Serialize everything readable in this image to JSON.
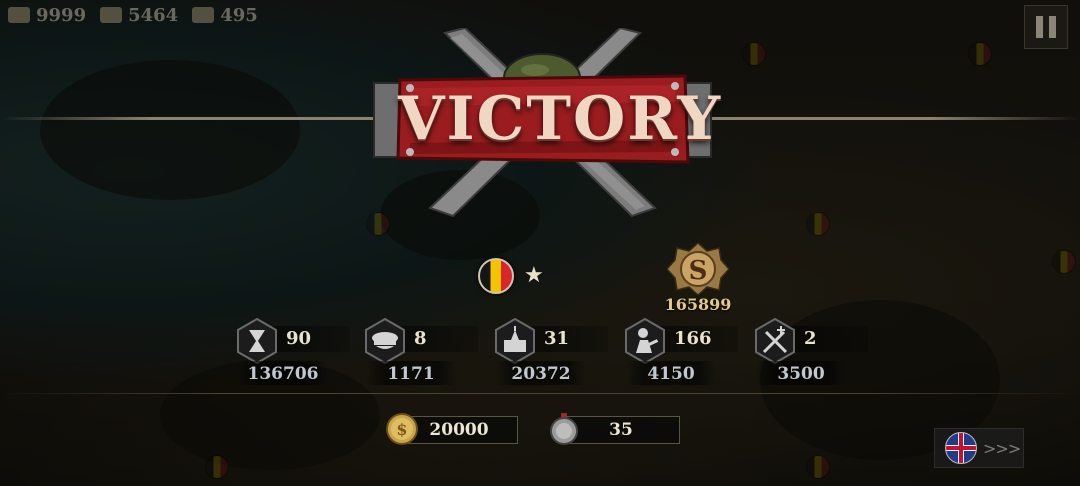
{
  "topbar": {
    "resources": [
      {
        "icon": "gold-icon",
        "value": "9999"
      },
      {
        "icon": "industry-icon",
        "value": "5464"
      },
      {
        "icon": "medal-icon",
        "value": "495"
      }
    ]
  },
  "banner": {
    "title": "VICTORY"
  },
  "faction": {
    "flag": "belgium-flag-icon",
    "rank": "★"
  },
  "reward": {
    "icon": "sovereign-emblem-icon",
    "value": "165899"
  },
  "stats": [
    {
      "icon": "hourglass-icon",
      "top": "90",
      "bottom": "136706"
    },
    {
      "icon": "officer-cap-icon",
      "top": "8",
      "bottom": "1171"
    },
    {
      "icon": "city-icon",
      "top": "31",
      "bottom": "20372"
    },
    {
      "icon": "soldier-icon",
      "top": "166",
      "bottom": "4150"
    },
    {
      "icon": "crossed-rifles-icon",
      "top": "2",
      "bottom": "3500"
    }
  ],
  "currency": [
    {
      "icon": "gold-coin-icon",
      "value": "20000"
    },
    {
      "icon": "silver-medal-icon",
      "value": "35"
    }
  ],
  "colors": {
    "banner_red": "#9a1c1f",
    "gold_text": "#e2c98a",
    "stat_bottom": "#c2c8d0"
  }
}
